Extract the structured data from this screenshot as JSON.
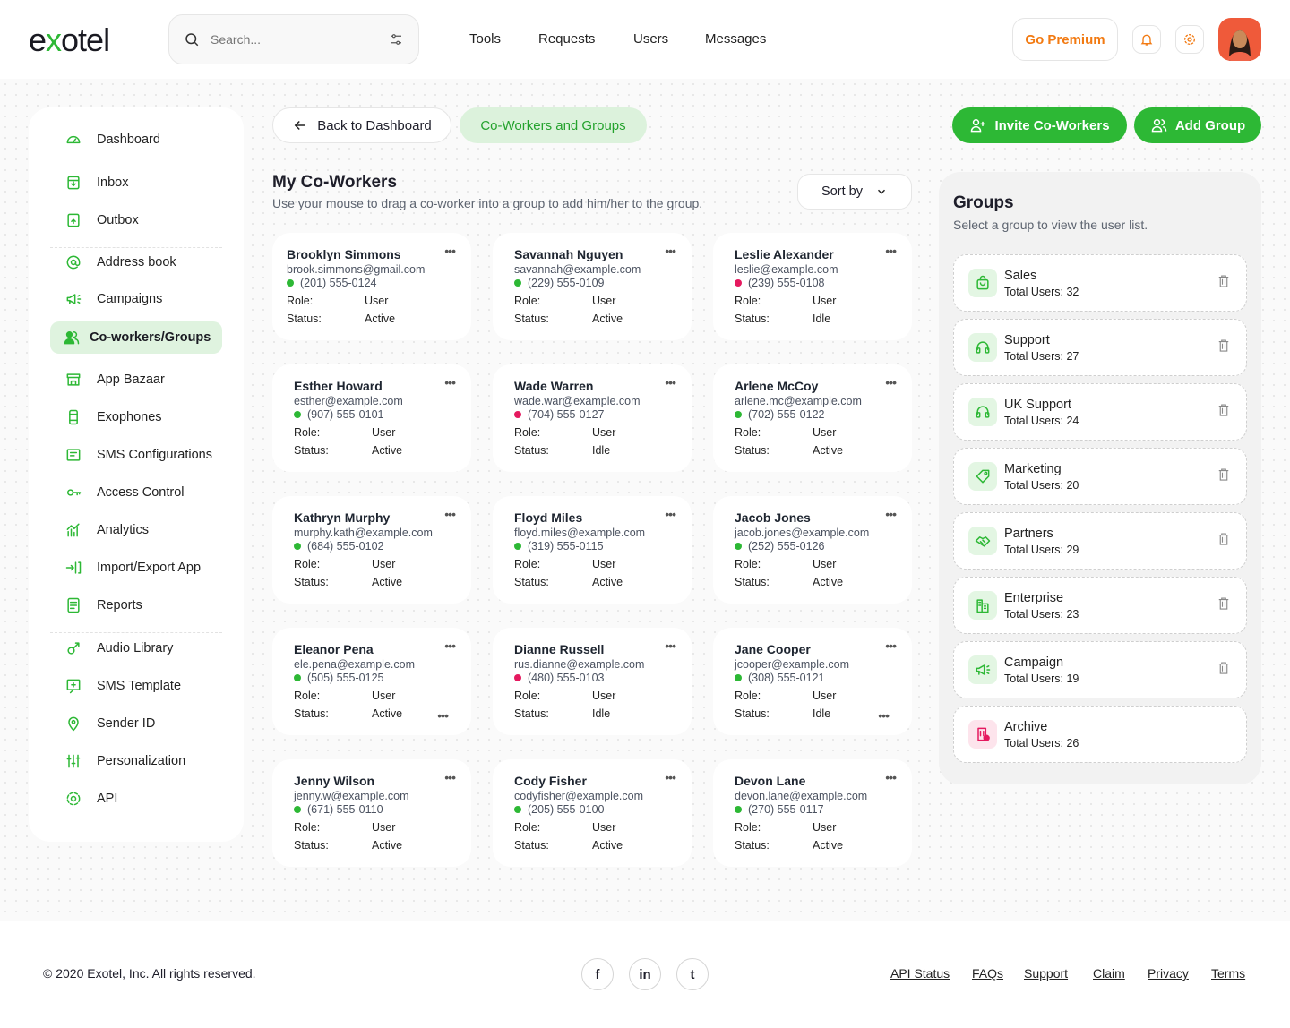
{
  "brand": {
    "logo": "exotel",
    "accent": "#2db835",
    "premium_color": "#f27a12"
  },
  "search": {
    "placeholder": "Search..."
  },
  "nav": [
    "Tools",
    "Requests",
    "Users",
    "Messages"
  ],
  "header": {
    "premium": "Go Premium"
  },
  "sidebar": {
    "items": [
      {
        "label": "Dashboard",
        "icon": "gauge-icon"
      },
      {
        "label": "Inbox",
        "icon": "inbox-icon"
      },
      {
        "label": "Outbox",
        "icon": "outbox-icon"
      },
      {
        "label": "Address book",
        "icon": "at-icon"
      },
      {
        "label": "Campaigns",
        "icon": "megaphone-icon"
      },
      {
        "label": "Co-workers/Groups",
        "icon": "users-icon",
        "active": true
      },
      {
        "label": "App Bazaar",
        "icon": "store-icon"
      },
      {
        "label": "Exophones",
        "icon": "phone-icon"
      },
      {
        "label": "SMS Configurations",
        "icon": "sms-config-icon"
      },
      {
        "label": "Access Control",
        "icon": "key-icon"
      },
      {
        "label": "Analytics",
        "icon": "chart-icon"
      },
      {
        "label": "Import/Export App",
        "icon": "import-icon"
      },
      {
        "label": "Reports",
        "icon": "report-icon"
      },
      {
        "label": "Audio Library",
        "icon": "audio-icon"
      },
      {
        "label": "SMS Template",
        "icon": "message-icon"
      },
      {
        "label": "Sender ID",
        "icon": "location-icon"
      },
      {
        "label": "Personalization",
        "icon": "sliders-icon"
      },
      {
        "label": "API",
        "icon": "gear-icon"
      }
    ]
  },
  "toolbar": {
    "back": "Back to Dashboard",
    "tab": "Co-Workers and Groups",
    "invite": "Invite Co-Workers",
    "add_group": "Add Group"
  },
  "coworkers": {
    "title": "My Co-Workers",
    "subtitle": "Use your mouse to drag a co-worker into a group to add him/her to the group.",
    "sort": "Sort by",
    "role_label": "Role:",
    "status_label": "Status:",
    "list": [
      {
        "name": "Brooklyn Simmons",
        "email": "brook.simmons@gmail.com",
        "phone": "(201) 555-0124",
        "online": true,
        "role": "User",
        "status": "Active"
      },
      {
        "name": "Savannah Nguyen",
        "email": "savannah@example.com",
        "phone": "(229) 555-0109",
        "online": true,
        "role": "User",
        "status": "Active"
      },
      {
        "name": "Leslie Alexander",
        "email": "leslie@example.com",
        "phone": "(239) 555-0108",
        "online": false,
        "role": "User",
        "status": "Idle"
      },
      {
        "name": "Esther Howard",
        "email": "esther@example.com",
        "phone": "(907) 555-0101",
        "online": true,
        "role": "User",
        "status": "Active"
      },
      {
        "name": "Wade Warren",
        "email": "wade.war@example.com",
        "phone": "(704) 555-0127",
        "online": false,
        "role": "User",
        "status": "Idle"
      },
      {
        "name": "Arlene McCoy",
        "email": "arlene.mc@example.com",
        "phone": "(702) 555-0122",
        "online": true,
        "role": "User",
        "status": "Active"
      },
      {
        "name": "Kathryn Murphy",
        "email": "murphy.kath@example.com",
        "phone": "(684) 555-0102",
        "online": true,
        "role": "User",
        "status": "Active"
      },
      {
        "name": "Floyd Miles",
        "email": "floyd.miles@example.com",
        "phone": "(319) 555-0115",
        "online": true,
        "role": "User",
        "status": "Active"
      },
      {
        "name": "Jacob Jones",
        "email": "jacob.jones@example.com",
        "phone": "(252) 555-0126",
        "online": true,
        "role": "User",
        "status": "Active"
      },
      {
        "name": "Eleanor Pena",
        "email": "ele.pena@example.com",
        "phone": "(505) 555-0125",
        "online": true,
        "role": "User",
        "status": "Active",
        "extra_menu": true
      },
      {
        "name": "Dianne Russell",
        "email": "rus.dianne@example.com",
        "phone": "(480) 555-0103",
        "online": false,
        "role": "User",
        "status": "Idle"
      },
      {
        "name": "Jane Cooper",
        "email": "jcooper@example.com",
        "phone": "(308) 555-0121",
        "online": true,
        "role": "User",
        "status": "Idle",
        "extra_menu": true
      },
      {
        "name": "Jenny Wilson",
        "email": "jenny.w@example.com",
        "phone": "(671) 555-0110",
        "online": true,
        "role": "User",
        "status": "Active"
      },
      {
        "name": "Cody Fisher",
        "email": "codyfisher@example.com",
        "phone": "(205) 555-0100",
        "online": true,
        "role": "User",
        "status": "Active"
      },
      {
        "name": "Devon Lane",
        "email": "devon.lane@example.com",
        "phone": "(270) 555-0117",
        "online": true,
        "role": "User",
        "status": "Active"
      }
    ],
    "online_color": "#2db835",
    "idle_color": "#e5195f"
  },
  "groups": {
    "title": "Groups",
    "subtitle": "Select a group to view the user list.",
    "count_prefix": "Total Users: ",
    "list": [
      {
        "name": "Sales",
        "count": "32",
        "icon": "bag-icon"
      },
      {
        "name": "Support",
        "count": "27",
        "icon": "headset-icon"
      },
      {
        "name": "UK Support",
        "count": "24",
        "icon": "headset-icon"
      },
      {
        "name": "Marketing",
        "count": "20",
        "icon": "tag-icon"
      },
      {
        "name": "Partners",
        "count": "29",
        "icon": "handshake-icon"
      },
      {
        "name": "Enterprise",
        "count": "23",
        "icon": "building-icon"
      },
      {
        "name": "Campaign",
        "count": "19",
        "icon": "megaphone-icon"
      },
      {
        "name": "Archive",
        "count": "26",
        "icon": "archive-icon",
        "no_delete": true
      }
    ]
  },
  "footer": {
    "copyright": "© 2020 Exotel, Inc. All rights reserved.",
    "social": [
      {
        "icon": "facebook-icon",
        "glyph": "f"
      },
      {
        "icon": "linkedin-icon",
        "glyph": "in"
      },
      {
        "icon": "twitter-icon",
        "glyph": "t"
      }
    ],
    "links": [
      "API Status",
      "FAQs",
      "Support",
      "Claim",
      "Privacy",
      "Terms"
    ]
  }
}
